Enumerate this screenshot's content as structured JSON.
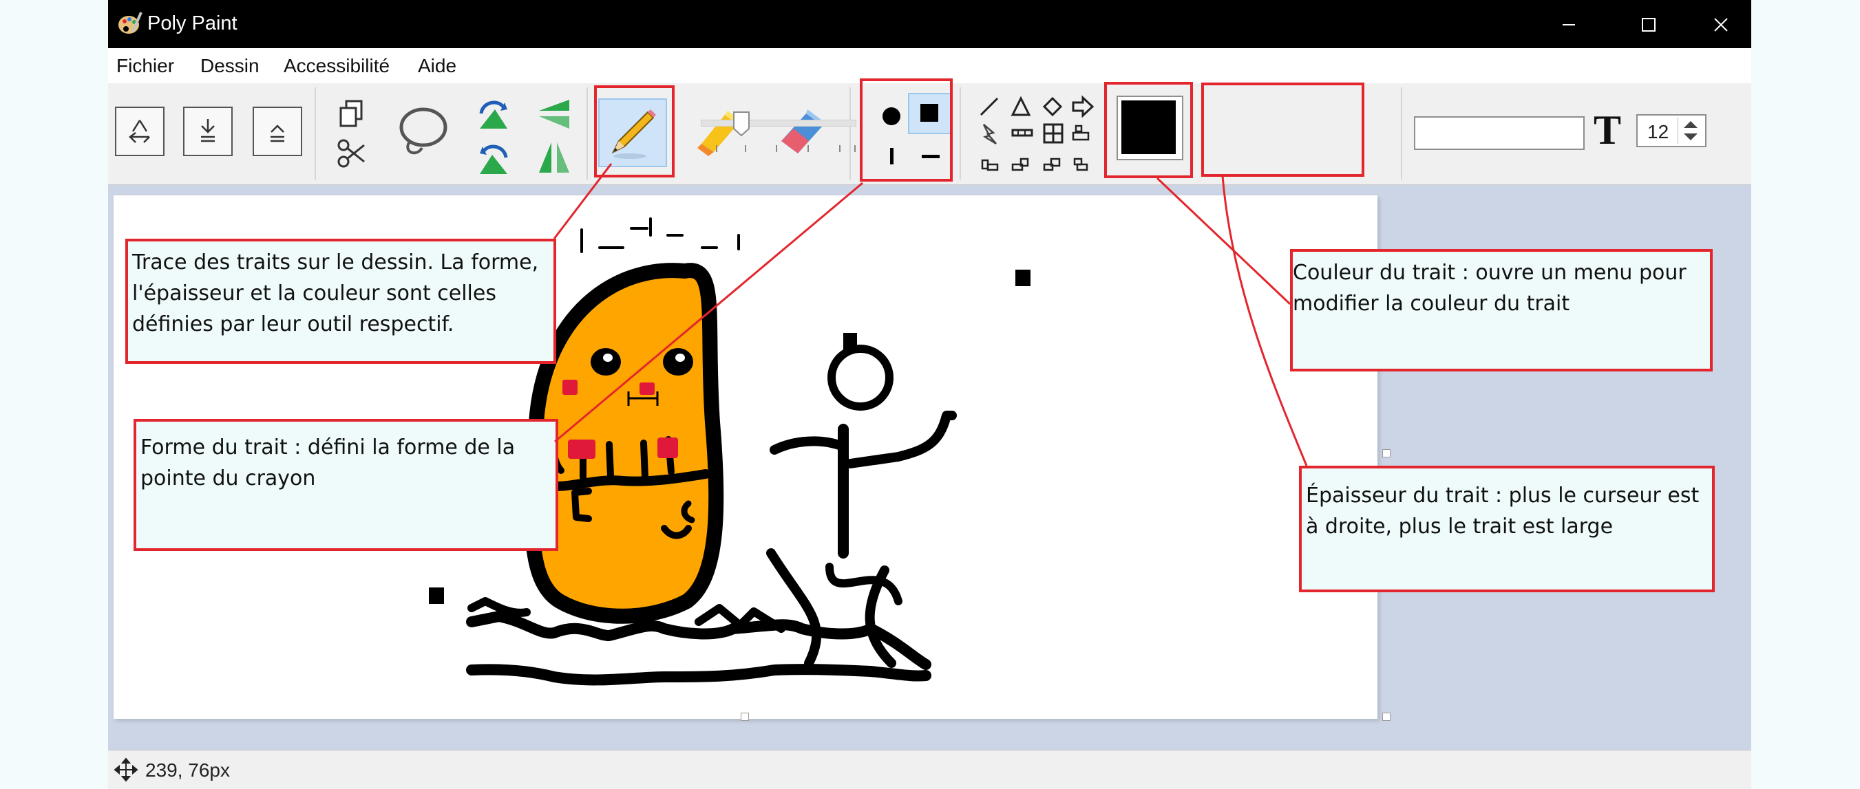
{
  "window": {
    "title": "Poly Paint",
    "controls": [
      "minimize-icon",
      "maximize-icon",
      "close-icon"
    ]
  },
  "menu": {
    "items": [
      "Fichier",
      "Dessin",
      "Accessibilité",
      "Aide"
    ]
  },
  "toolbar": {
    "icons": [
      "recycle-icon",
      "send-backward-icon",
      "bring-forward-icon",
      "copy-icon",
      "cut-icon",
      "lasso-icon",
      "rotate-icon",
      "flip-icon",
      "pencil-icon",
      "highlighter-icon",
      "eraser-icon",
      "round-tip-icon",
      "square-tip-icon",
      "vertical-tip-icon",
      "horizontal-tip-icon",
      "line-shape-icon",
      "triangle-shape-icon",
      "diamond-shape-icon",
      "arrow-shape-icon",
      "lightning-shape-icon",
      "dashed-line-icon",
      "grid-shape-icon",
      "class-shape-icon",
      "color-swatch-icon",
      "text-tool-icon"
    ],
    "selected_tool": "pencil",
    "stroke_color": "#000000",
    "stroke_thickness_fraction": 0.12,
    "text_input_value": "",
    "font_size": "12"
  },
  "annotations": {
    "pencil": "Trace des traits sur le dessin. La forme, l'épaisseur et la couleur sont celles définies par leur outil respectif.",
    "stroke_shape": "Forme du trait : défini la forme de la pointe du crayon",
    "stroke_color": "Couleur du trait : ouvre un menu pour modifier la couleur du trait",
    "stroke_thickness": "Épaisseur du trait : plus le curseur est à droite, plus le trait est large"
  },
  "colors": {
    "highlight": "#e3262d",
    "potato_fill": "#ffa500",
    "cheek": "#e0193a",
    "canvas_background": "#ccd5e6"
  },
  "status": {
    "coordinates": "239, 76px"
  }
}
